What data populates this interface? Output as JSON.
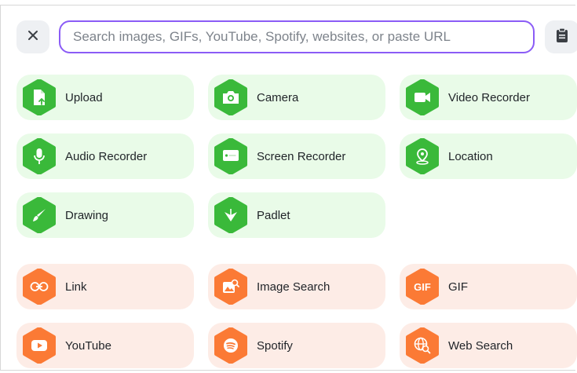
{
  "search": {
    "placeholder": "Search images, GIFs, YouTube, Spotify, websites, or paste URL",
    "value": ""
  },
  "colors": {
    "accent": "#8b5cf6",
    "green_tile": "#e9fbe8",
    "green_icon": "#3ab93a",
    "orange_tile": "#fdece6",
    "orange_icon": "#fb7a35"
  },
  "capture_options": [
    {
      "label": "Upload",
      "icon": "upload-file-icon"
    },
    {
      "label": "Camera",
      "icon": "camera-icon"
    },
    {
      "label": "Video Recorder",
      "icon": "video-camera-icon"
    },
    {
      "label": "Audio Recorder",
      "icon": "microphone-icon"
    },
    {
      "label": "Screen Recorder",
      "icon": "screen-record-icon"
    },
    {
      "label": "Location",
      "icon": "location-pin-icon"
    },
    {
      "label": "Drawing",
      "icon": "brush-icon"
    },
    {
      "label": "Padlet",
      "icon": "padlet-logo-icon"
    }
  ],
  "web_options": [
    {
      "label": "Link",
      "icon": "link-icon"
    },
    {
      "label": "Image Search",
      "icon": "image-search-icon"
    },
    {
      "label": "GIF",
      "icon": "gif-icon",
      "icon_text": "GIF"
    },
    {
      "label": "YouTube",
      "icon": "youtube-icon"
    },
    {
      "label": "Spotify",
      "icon": "spotify-icon"
    },
    {
      "label": "Web Search",
      "icon": "web-search-icon"
    }
  ]
}
